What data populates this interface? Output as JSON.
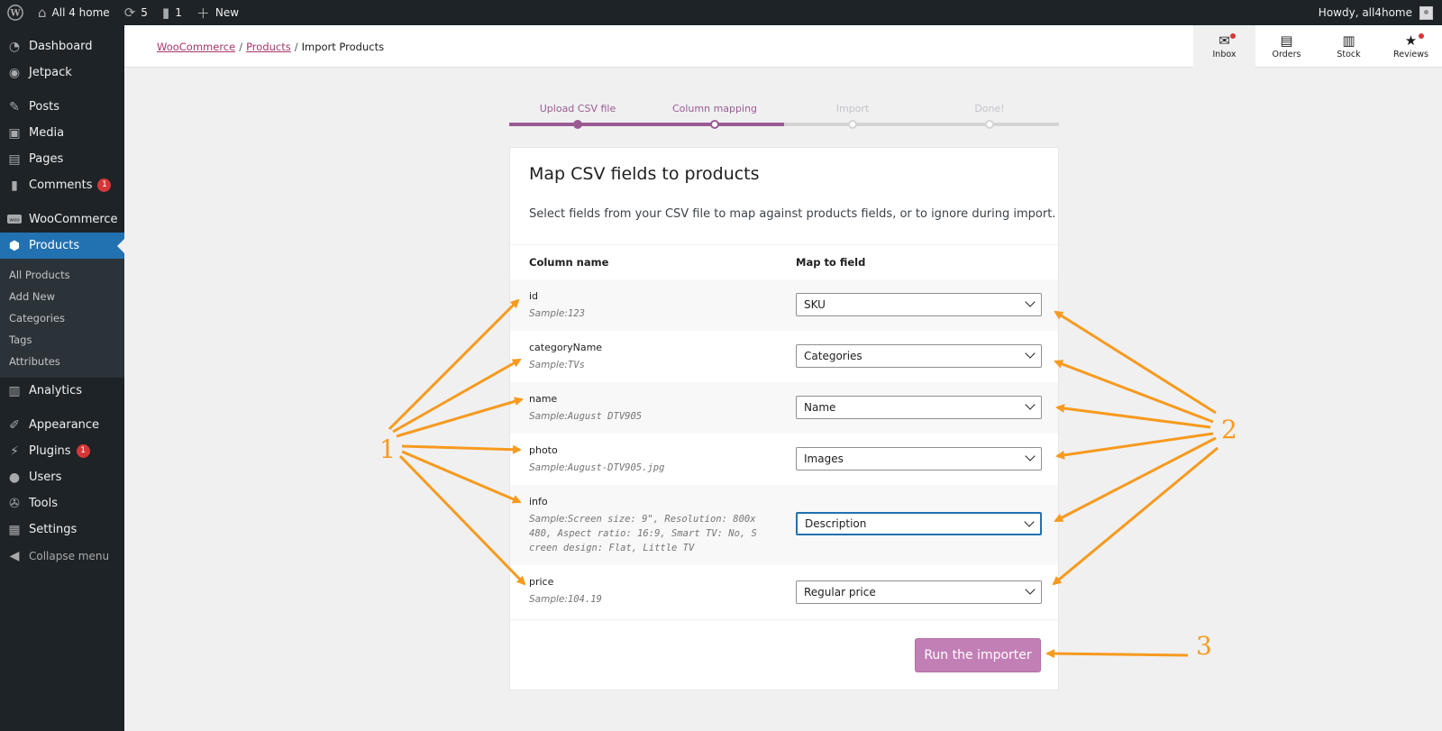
{
  "adminbar": {
    "site_name": "All 4 home",
    "updates_count": "5",
    "comments_count": "1",
    "new_label": "New",
    "howdy": "Howdy, all4home"
  },
  "sidebar": {
    "items": [
      {
        "label": "Dashboard",
        "icon": "dashboard-icon"
      },
      {
        "label": "Jetpack",
        "icon": "jetpack-icon"
      },
      {
        "label": "Posts",
        "icon": "pin-icon"
      },
      {
        "label": "Media",
        "icon": "media-icon"
      },
      {
        "label": "Pages",
        "icon": "pages-icon"
      },
      {
        "label": "Comments",
        "icon": "comment-icon",
        "badge": "1"
      },
      {
        "label": "WooCommerce",
        "icon": "woo-icon"
      },
      {
        "label": "Products",
        "icon": "box-icon"
      },
      {
        "label": "Analytics",
        "icon": "chart-icon"
      },
      {
        "label": "Appearance",
        "icon": "brush-icon"
      },
      {
        "label": "Plugins",
        "icon": "plug-icon",
        "badge": "1"
      },
      {
        "label": "Users",
        "icon": "user-icon"
      },
      {
        "label": "Tools",
        "icon": "wrench-icon"
      },
      {
        "label": "Settings",
        "icon": "settings-icon"
      }
    ],
    "submenu": [
      "All Products",
      "Add New",
      "Categories",
      "Tags",
      "Attributes"
    ],
    "collapse_label": "Collapse menu"
  },
  "header": {
    "breadcrumb": [
      "WooCommerce",
      "Products",
      "Import Products"
    ],
    "activity": [
      "Inbox",
      "Orders",
      "Stock",
      "Reviews"
    ]
  },
  "stepper": {
    "steps": [
      "Upload CSV file",
      "Column mapping",
      "Import",
      "Done!"
    ],
    "current_step": 2,
    "active_color": "#9a5b93",
    "inactive_color": "#d4d4d4"
  },
  "card": {
    "title": "Map CSV fields to products",
    "description": "Select fields from your CSV file to map against products fields, or to ignore during import.",
    "column_header": "Column name",
    "map_header": "Map to field",
    "sample_label": "Sample:",
    "rows": [
      {
        "name": "id",
        "sample": "123",
        "field": "SKU"
      },
      {
        "name": "categoryName",
        "sample": "TVs",
        "field": "Categories"
      },
      {
        "name": "name",
        "sample": "August DTV905",
        "field": "Name"
      },
      {
        "name": "photo",
        "sample": "August-DTV905.jpg",
        "field": "Images"
      },
      {
        "name": "info",
        "sample": "Screen size: 9\", Resolution: 800x 480, Aspect ratio: 16:9, Smart TV: No, S creen design: Flat, Little TV",
        "field": "Description"
      },
      {
        "name": "price",
        "sample": "104.19",
        "field": "Regular price"
      }
    ],
    "run_button": "Run the importer"
  },
  "annotations": {
    "labels": [
      "1",
      "2",
      "3"
    ],
    "color": "#f79a1e"
  }
}
